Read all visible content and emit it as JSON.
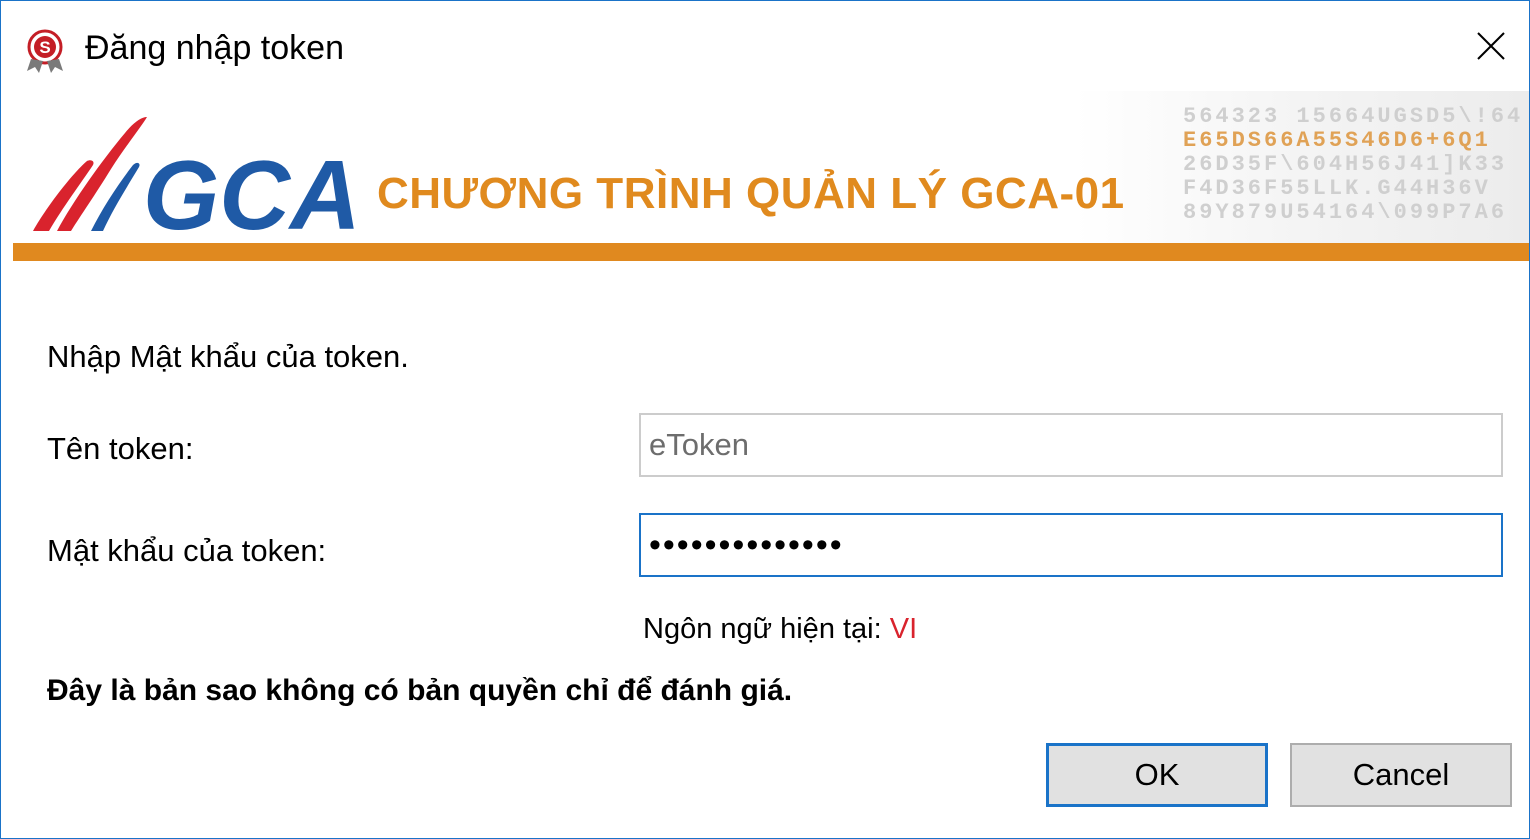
{
  "window": {
    "title": "Đăng nhập token",
    "close_glyph": "✕"
  },
  "banner": {
    "logo_text": "GCA",
    "title": "CHƯƠNG TRÌNH QUẢN LÝ GCA-01",
    "code_rows": [
      "564323 15664UGSD5\\!64",
      "E65DS66A55S46D6+6Q1",
      "26D35F\\604H56J41]K33",
      "F4D36F55LLK.G44H36V",
      "89Y879U54164\\099P7A6"
    ]
  },
  "form": {
    "instruction": "Nhập Mật khẩu của token.",
    "token_name_label": "Tên token:",
    "token_name_value": "eToken",
    "password_label": "Mật khẩu của token:",
    "password_value": "••••••••••••••",
    "language_label": "Ngôn ngữ hiện tại:",
    "language_value": "VI",
    "warning": "Đây là bản sao không có bản quyền chỉ để đánh giá."
  },
  "buttons": {
    "ok": "OK",
    "cancel": "Cancel"
  },
  "colors": {
    "accent_orange": "#e0891f",
    "logo_red": "#d9232d",
    "logo_blue": "#1f5aa6",
    "focus_blue": "#1a73c8"
  },
  "icons": {
    "app_icon": "seal-s-icon",
    "close": "close-icon"
  }
}
